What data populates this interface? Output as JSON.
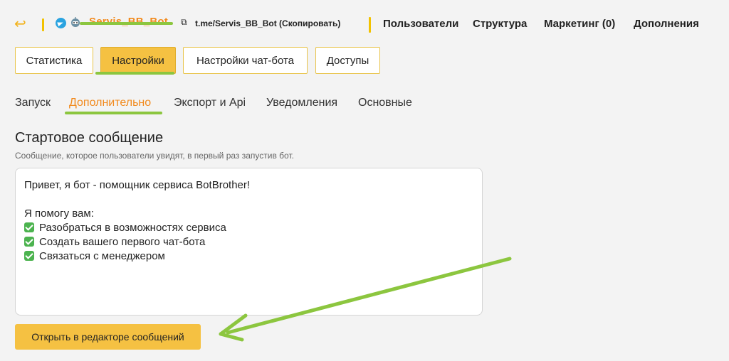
{
  "header": {
    "back_icon": "back-arrow-icon",
    "bot_name": "Servis_BB_Bot",
    "bot_link": "t.me/Servis_BB_Bot (Скопировать)",
    "nav": [
      "Пользователи",
      "Структура",
      "Маркетинг (0)",
      "Дополнения"
    ]
  },
  "tabs": [
    {
      "label": "Статистика",
      "active": false
    },
    {
      "label": "Настройки",
      "active": true
    },
    {
      "label": "Настройки чат-бота",
      "active": false
    },
    {
      "label": "Доступы",
      "active": false
    }
  ],
  "subtabs": [
    {
      "label": "Запуск",
      "active": false
    },
    {
      "label": "Дополнительно",
      "active": true
    },
    {
      "label": "Экспорт и Api",
      "active": false
    },
    {
      "label": "Уведомления",
      "active": false
    },
    {
      "label": "Основные",
      "active": false
    }
  ],
  "section": {
    "title": "Стартовое сообщение",
    "description": "Сообщение, которое пользователи увидят, в первый раз запустив бот."
  },
  "message": {
    "greeting": "Привет, я бот - помощник сервиса BotBrother!",
    "intro": "Я помогу вам:",
    "items": [
      "Разобраться в возможностях сервиса",
      "Создать вашего первого чат-бота",
      "Связаться с менеджером"
    ]
  },
  "open_button": "Открыть в редакторе сообщений",
  "colors": {
    "accent_yellow": "#f5c142",
    "accent_orange": "#f28a1d",
    "annotation_green": "#8cc63f",
    "check_green": "#4cb34f"
  }
}
